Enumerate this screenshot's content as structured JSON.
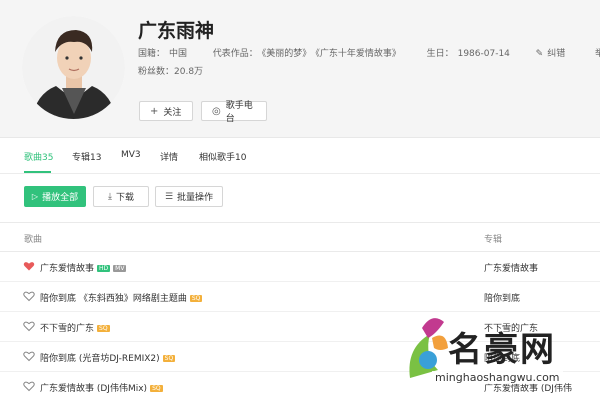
{
  "singer": {
    "name": "广东雨神",
    "region_label": "国籍：",
    "region": "中国",
    "works_label": "代表作品：",
    "works": [
      "《美丽的梦》",
      "《广东十年爱情故事》"
    ],
    "birthday_label": "生日：",
    "birthday": "1986-07-14",
    "correct_label": "纠错",
    "report_label": "举报",
    "fans_label": "粉丝数：",
    "fans": "20.8万",
    "follow_label": "关注",
    "radio_label": "歌手电台"
  },
  "tabs": [
    {
      "label": "歌曲35"
    },
    {
      "label": "专辑13"
    },
    {
      "label": "MV3"
    },
    {
      "label": "详情"
    },
    {
      "label": "相似歌手10"
    }
  ],
  "actions": {
    "play_all": "播放全部",
    "download": "下载",
    "batch": "批量操作"
  },
  "table": {
    "col_song": "歌曲",
    "col_album": "专辑"
  },
  "songs": [
    {
      "title": "广东爱情故事",
      "badges": [
        "HD",
        "MV"
      ],
      "album": "广东爱情故事",
      "liked": true
    },
    {
      "title": "陪你到底 《东斜西独》网络剧主题曲",
      "badges": [
        "SQ"
      ],
      "album": "陪你到底",
      "liked": false
    },
    {
      "title": "不下雪的广东",
      "badges": [
        "SQ"
      ],
      "album": "不下雪的广东",
      "liked": false
    },
    {
      "title": "陪你到底 (光音坊DJ-REMIX2)",
      "badges": [
        "SQ"
      ],
      "album": "陪你到底",
      "liked": false
    },
    {
      "title": "广东爱情故事 (DJ伟伟Mix)",
      "badges": [
        "SQ"
      ],
      "album": "广东爱情故事 (DJ伟伟",
      "liked": false
    }
  ],
  "watermark": {
    "text": "名豪网",
    "url": "minghaoshangwu.com"
  },
  "colors": {
    "accent": "#31c27c",
    "heart": "#e85a5a",
    "sq_badge": "#f3b03b"
  },
  "icons": {
    "follow": "plus-icon",
    "radio": "radio-icon",
    "play": "play-icon",
    "download": "download-icon",
    "batch": "list-icon",
    "correct": "edit-icon",
    "like": "heart-icon"
  }
}
